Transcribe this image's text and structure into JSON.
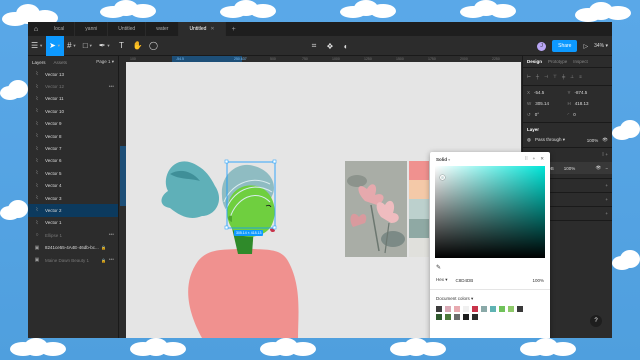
{
  "tabs": [
    {
      "label": "local",
      "active": false
    },
    {
      "label": "yanni",
      "active": false
    },
    {
      "label": "Untitled",
      "active": false
    },
    {
      "label": "water",
      "active": false
    },
    {
      "label": "Untitled",
      "active": true
    }
  ],
  "toolbar": {
    "avatar_initial": "J",
    "share_label": "Share",
    "zoom": "34%"
  },
  "layers_panel": {
    "tab_layers": "Layers",
    "tab_assets": "Assets",
    "page_label": "Page 1",
    "items": [
      {
        "label": "Vector 13",
        "icon": "vector-icon",
        "dim": false
      },
      {
        "label": "Vector 12",
        "icon": "vector-icon",
        "dim": true
      },
      {
        "label": "Vector 11",
        "icon": "vector-icon",
        "dim": false
      },
      {
        "label": "Vector 10",
        "icon": "vector-icon",
        "dim": false
      },
      {
        "label": "Vector 9",
        "icon": "vector-icon",
        "dim": false
      },
      {
        "label": "Vector 8",
        "icon": "vector-icon",
        "dim": false
      },
      {
        "label": "Vector 7",
        "icon": "vector-icon",
        "dim": false
      },
      {
        "label": "Vector 6",
        "icon": "vector-icon",
        "dim": false
      },
      {
        "label": "Vector 5",
        "icon": "vector-icon",
        "dim": false
      },
      {
        "label": "Vector 4",
        "icon": "vector-icon",
        "dim": false
      },
      {
        "label": "Vector 3",
        "icon": "vector-icon",
        "dim": false
      },
      {
        "label": "Vector 2",
        "icon": "vector-icon",
        "dim": false,
        "selected": true
      },
      {
        "label": "Vector 1",
        "icon": "vector-icon",
        "dim": false
      },
      {
        "label": "Ellipse 1",
        "icon": "ellipse-icon",
        "dim": true
      },
      {
        "label": "8241ce55-4A4E-46db-bc...",
        "icon": "image-icon",
        "dim": false
      },
      {
        "label": "Maine Dawn Beauty 1",
        "icon": "image-icon",
        "dim": true
      }
    ]
  },
  "canvas": {
    "ruler_ticks": [
      "100",
      "-54.5",
      "250.637",
      "500",
      "750",
      "1000",
      "1250",
      "1500",
      "1750",
      "2000",
      "2250",
      "2500"
    ],
    "selection_label": "305.14 × 418.13",
    "left_ruler_ticks": [
      "-874.5",
      "-456"
    ]
  },
  "color_picker": {
    "mode": "Solid",
    "format": "Hex",
    "hex": "C8D4DB",
    "opacity": "100%",
    "doc_colors_label": "Document colors",
    "doc_colors": [
      "#3c3c3c",
      "#d9a9b5",
      "#e8aab0",
      "#f0f0f0",
      "#c8334a",
      "#8aa9a8",
      "#5fb3b3",
      "#70c25a",
      "#8ec96a",
      "#3a3a3a",
      "#305a2e",
      "#4d7a3a",
      "#6b6b6b",
      "#1e1e1e",
      "#2b2b2b"
    ]
  },
  "properties": {
    "tab_design": "Design",
    "tab_prototype": "Prototype",
    "tab_inspect": "Inspect",
    "x_label": "X",
    "x": "-54.5",
    "y_label": "Y",
    "y": "-874.5",
    "w_label": "W",
    "w": "305.14",
    "h_label": "H",
    "h": "418.13",
    "rot_label": "↺",
    "rotation": "0°",
    "radius_label": "◜",
    "radius": "0",
    "layer_title": "Layer",
    "blend": "Pass through",
    "layer_opacity": "100%",
    "fill_title": "Fill",
    "fill_hex": "C8D4DB",
    "fill_opacity": "100%",
    "stroke_title": "Stroke",
    "effects_title": "Effects",
    "export_title": "Export"
  },
  "colors": {
    "accent": "#0d99ff",
    "panel": "#2c2c2c",
    "canvas": "#e5e5e5",
    "head_green": "#6fcf3f",
    "hair_teal": "#5fb0b8",
    "body_pink": "#f0918f"
  }
}
